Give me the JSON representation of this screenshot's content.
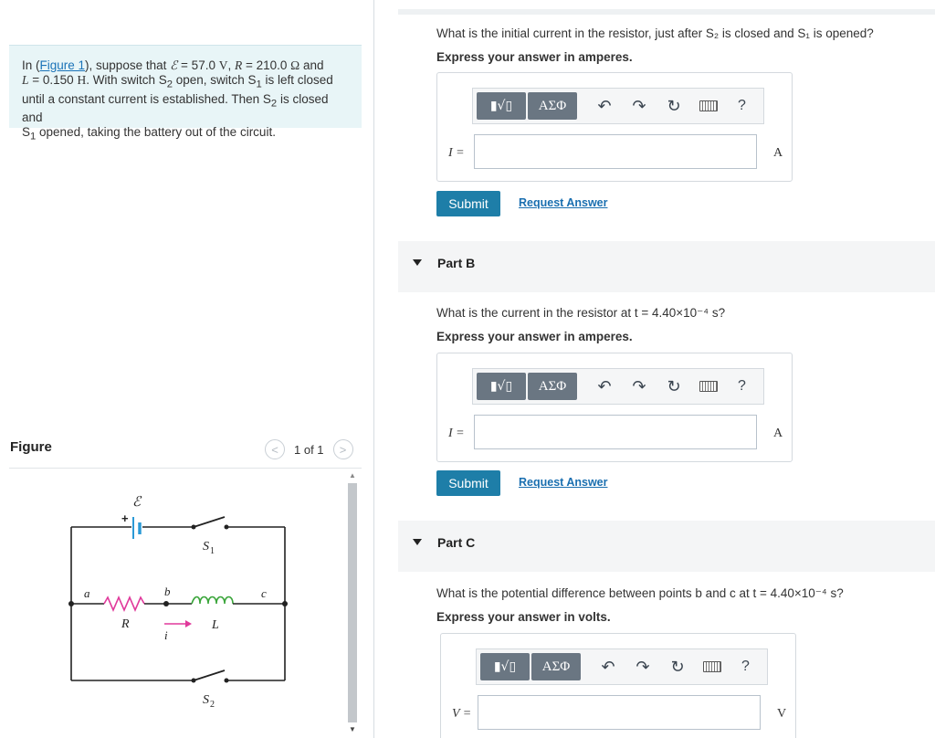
{
  "problem": {
    "lead": "In (",
    "figure_link": "Figure 1",
    "t1": "), suppose that ",
    "emf_sym": "ℰ",
    "t2": " = 57.0 ",
    "emf_unit": "V",
    "t3": ", ",
    "r_sym": "R",
    "t4": " = 210.0 ",
    "r_unit": "Ω",
    "t5": " and",
    "l_sym": "L",
    "t6": " = 0.150 ",
    "l_unit": "H",
    "t7": ". With switch S",
    "s2": "2",
    "t8": " open, switch S",
    "s1": "1",
    "t9": " is left closed",
    "t10": "until a constant current is established. Then S",
    "t11": " is closed and",
    "t12": "S",
    "t13": " opened, taking the battery out of the circuit."
  },
  "figure": {
    "title": "Figure",
    "prev": "<",
    "next": ">",
    "count": "1 of 1",
    "labels": {
      "emf": "ℰ",
      "plus": "+",
      "s1": "S",
      "s1sub": "1",
      "a": "a",
      "b": "b",
      "c": "c",
      "R": "R",
      "i": "i",
      "L": "L",
      "s2": "S",
      "s2sub": "2"
    }
  },
  "scroll": {
    "up": "▲",
    "down": "▼"
  },
  "partA": {
    "question": "What is the initial current in the resistor, just after S₂ is closed and S₁ is opened?",
    "express": "Express your answer in amperes.",
    "var": "I =",
    "unit": "A",
    "submit": "Submit",
    "request": "Request Answer"
  },
  "partB": {
    "header": "Part B",
    "question": "What is the current in the resistor at t = 4.40×10⁻⁴ s?",
    "express": "Express your answer in amperes.",
    "var": "I =",
    "unit": "A",
    "submit": "Submit",
    "request": "Request Answer"
  },
  "partC": {
    "header": "Part C",
    "question": "What is the potential difference between points b and c at t = 4.40×10⁻⁴ s?",
    "express": "Express your answer in volts.",
    "var": "V =",
    "unit": "V"
  },
  "toolbar": {
    "template": "▮√▯",
    "greek": "ΑΣΦ",
    "undo": "↶",
    "redo": "↷",
    "reset": "↻",
    "help": "?"
  },
  "colors": {
    "accent": "#1e7ea8",
    "link": "#1a6fb0",
    "problem_bg": "#e8f5f7",
    "resistor": "#e0399b",
    "inductor": "#3aa53a",
    "battery": "#2b9ad6"
  }
}
